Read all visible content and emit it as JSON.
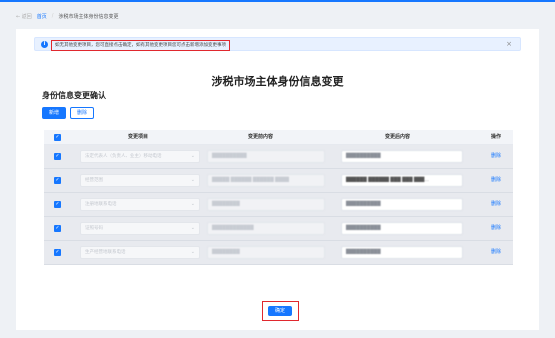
{
  "nav": {
    "back": "← 返回",
    "home": "首页",
    "separator": "/",
    "current": "涉税市场主体身份信息变更"
  },
  "alert": {
    "message": "如无其他变更项目，您可直接点击确定，如有其他变更项目您可点击新增添加变更事项",
    "close": "×"
  },
  "page_title": "涉税市场主体身份信息变更",
  "section_title": "身份信息变更确认",
  "toolbar": {
    "add_label": "新增",
    "delete_label": "删除"
  },
  "table": {
    "headers": {
      "item": "变更项目",
      "before": "变更前内容",
      "after": "变更后内容",
      "action": "操作"
    },
    "rows": [
      {
        "item": "法定代表人（负责人、业主）移动电话",
        "before": "██████████",
        "after": "██████████",
        "action": "删除"
      },
      {
        "item": "经营范围",
        "before": "█████ ██████ ██████ ████",
        "after": "██████ ██████ ███ ███ ███…",
        "action": "删除"
      },
      {
        "item": "注册地联系电话",
        "before": "████████",
        "after": "██████████",
        "action": "删除"
      },
      {
        "item": "证照号码",
        "before": "████████████",
        "after": "██████████",
        "action": "删除"
      },
      {
        "item": "生产经营地联系电话",
        "before": "████████",
        "after": "██████████",
        "action": "删除"
      }
    ]
  },
  "confirm_label": "确定",
  "colors": {
    "primary": "#1677ff",
    "highlight": "#e0282e",
    "alert_bg": "#e8f1ff"
  }
}
